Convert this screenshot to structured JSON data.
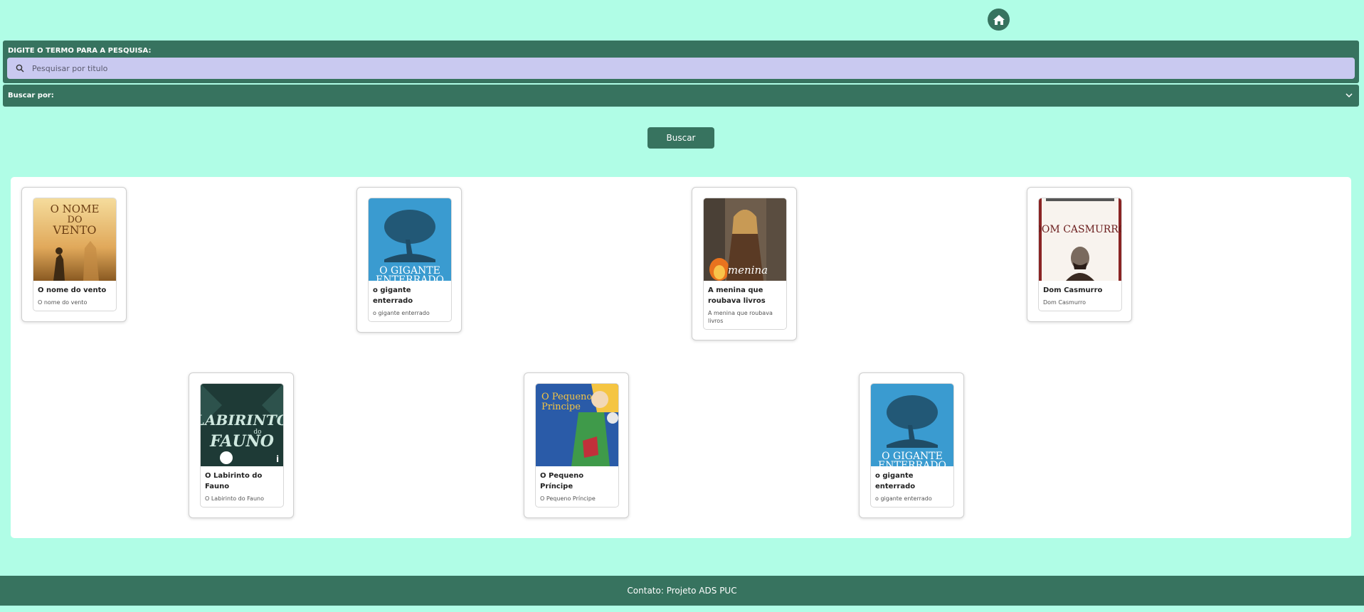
{
  "nav": {
    "home_icon": "home-icon"
  },
  "search": {
    "label": "DIGITE O TERMO PARA A PESQUISA:",
    "placeholder": "Pesquisar por titulo",
    "value": "",
    "icon": "search-icon"
  },
  "filter": {
    "label": "Buscar por:",
    "icon": "chevron-down-icon"
  },
  "buscar_label": "Buscar",
  "books": [
    {
      "title": "O nome do vento",
      "subtitle": "O nome do vento"
    },
    {
      "title": "o gigante enterrado",
      "subtitle": "o gigante enterrado"
    },
    {
      "title": "A menina que roubava livros",
      "subtitle": "A menina que roubava livros"
    },
    {
      "title": "Dom Casmurro",
      "subtitle": "Dom Casmurro"
    },
    {
      "title": "O Labirinto do Fauno",
      "subtitle": "O Labirinto do Fauno"
    },
    {
      "title": "O Pequeno Príncipe",
      "subtitle": "O Pequeno Príncipe"
    },
    {
      "title": "o gigante enterrado",
      "subtitle": "o gigante enterrado"
    }
  ],
  "covers": {
    "nome_do_vento": {
      "line1": "O NOME",
      "line2": "DO",
      "line3": "VENTO"
    },
    "gigante": {
      "line1": "O GIGANTE",
      "line2": "ENTERRADO"
    },
    "menina": {
      "line1": "menina"
    },
    "dom_casmurro": {
      "line1": "DOM CASMURRO"
    },
    "labirinto": {
      "line1": "LABIRINTO",
      "line2": "do",
      "line3": "FAUNO"
    },
    "pequeno_principe": {
      "line1": "O Pequeno",
      "line2": "Principe"
    }
  },
  "footer": {
    "text": "Contato: Projeto ADS PUC"
  },
  "colors": {
    "background": "#b0fde6",
    "primary": "#37735f",
    "search_bg": "#c9c9f0"
  }
}
